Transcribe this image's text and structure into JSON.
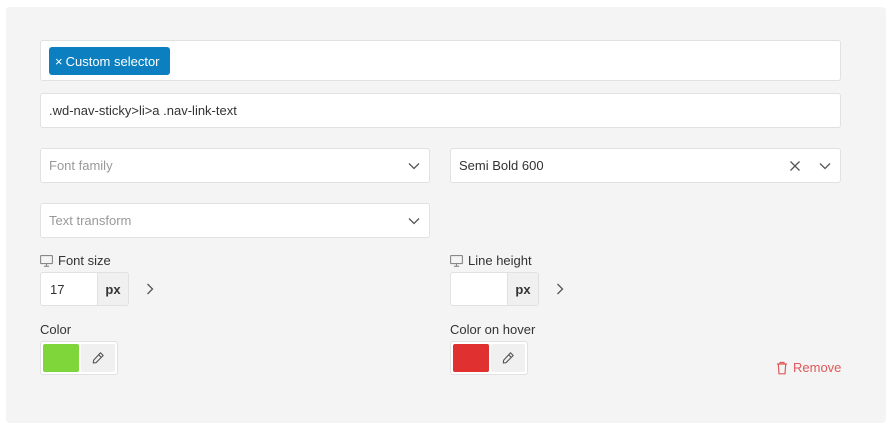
{
  "selector": {
    "tag_label": "Custom selector",
    "tag_remove_glyph": "×",
    "custom_value": ".wd-nav-sticky>li>a .nav-link-text"
  },
  "font_family": {
    "placeholder": "Font family"
  },
  "font_weight": {
    "value": "Semi Bold 600"
  },
  "text_transform": {
    "placeholder": "Text transform"
  },
  "font_size": {
    "label": "Font size",
    "value": "17",
    "unit": "px"
  },
  "line_height": {
    "label": "Line height",
    "value": "",
    "unit": "px"
  },
  "color": {
    "label": "Color",
    "swatch": "#7ed63b"
  },
  "color_hover": {
    "label": "Color on hover",
    "swatch": "#e03030"
  },
  "remove": {
    "label": "Remove"
  },
  "colors": {
    "accent": "#0b7fc0",
    "danger": "#e0585a"
  }
}
